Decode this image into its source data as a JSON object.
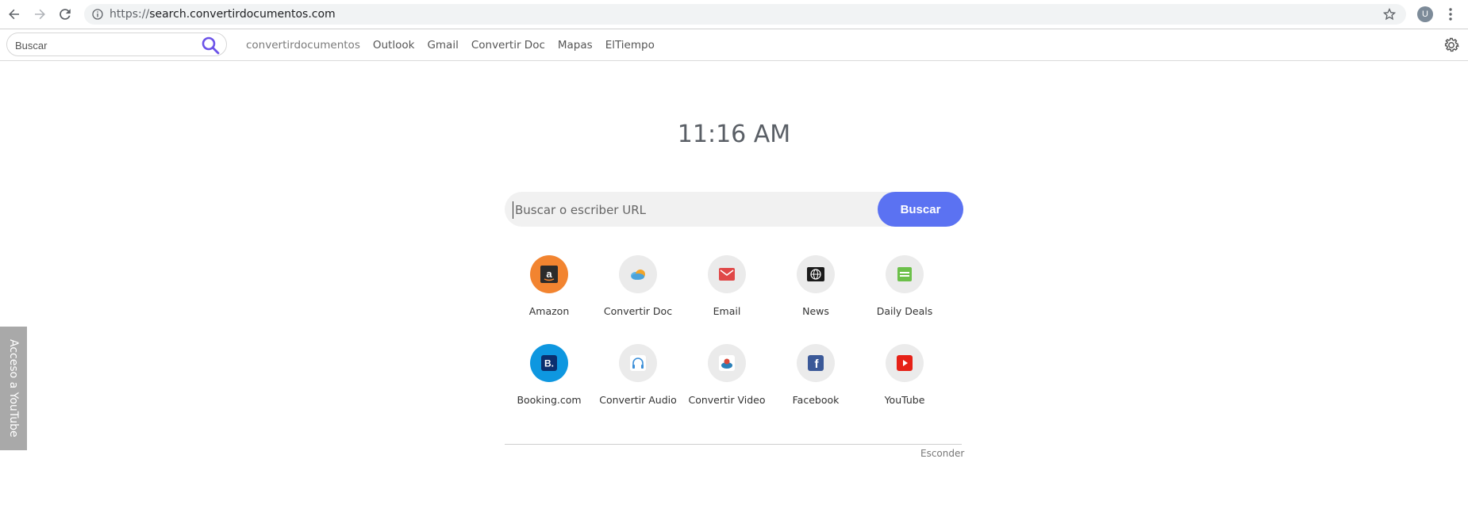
{
  "browser": {
    "url_scheme": "https://",
    "url_host": "search.convertirdocumentos.com",
    "avatar_letter": "U"
  },
  "toolbar": {
    "search_placeholder": "Buscar",
    "links": [
      "convertirdocumentos",
      "Outlook",
      "Gmail",
      "Convertir Doc",
      "Mapas",
      "ElTiempo"
    ]
  },
  "main": {
    "time": "11:16 AM",
    "search_placeholder": "Buscar o escriber URL",
    "search_button": "Buscar",
    "hide_label": "Esconder"
  },
  "tiles": [
    {
      "label": "Amazon",
      "icon": "amazon-icon",
      "color": "#f28430"
    },
    {
      "label": "Convertir Doc",
      "icon": "cloud-icon",
      "color": "#ebebeb"
    },
    {
      "label": "Email",
      "icon": "envelope-icon",
      "color": "#ebebeb"
    },
    {
      "label": "News",
      "icon": "globe-news-icon",
      "color": "#ebebeb"
    },
    {
      "label": "Daily Deals",
      "icon": "daily-deals-icon",
      "color": "#ebebeb"
    },
    {
      "label": "Booking.com",
      "icon": "booking-icon",
      "color": "#0e97e0"
    },
    {
      "label": "Convertir Audio",
      "icon": "headphones-icon",
      "color": "#ebebeb"
    },
    {
      "label": "Convertir Video",
      "icon": "video-disc-icon",
      "color": "#ebebeb"
    },
    {
      "label": "Facebook",
      "icon": "facebook-icon",
      "color": "#ebebeb"
    },
    {
      "label": "YouTube",
      "icon": "youtube-icon",
      "color": "#ebebeb"
    }
  ],
  "side_tab": {
    "label": "Acceso a YouTube"
  },
  "colors": {
    "accent": "#5b72f2"
  }
}
